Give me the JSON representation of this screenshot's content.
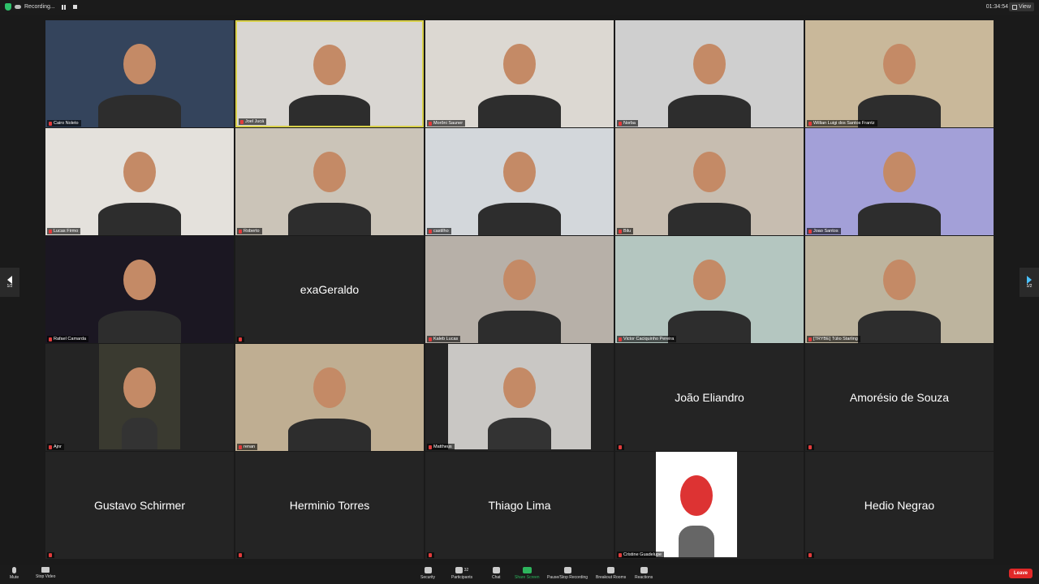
{
  "topbar": {
    "recording_label": "Recording...",
    "clock": "01:34:54",
    "view_label": "View"
  },
  "participants": [
    {
      "name": "Cairo Noleto",
      "video": true,
      "bg": "#34445c"
    },
    {
      "name": "Joel Jucá",
      "video": true,
      "bg": "#d9d6d2"
    },
    {
      "name": "Morôni Sauner",
      "video": true,
      "bg": "#dcd8d2"
    },
    {
      "name": "Norba",
      "video": true,
      "bg": "#cfcfcf"
    },
    {
      "name": "Willian Luigi dos Santos Frantz",
      "video": true,
      "bg": "#c9b89a"
    },
    {
      "name": "Lucas Firmo",
      "video": true,
      "bg": "#e4e1dc"
    },
    {
      "name": "Roberto",
      "video": true,
      "bg": "#cbc4b8"
    },
    {
      "name": "castilho",
      "video": true,
      "bg": "#d3d7db"
    },
    {
      "name": "Bilu",
      "video": true,
      "bg": "#c7bdb0"
    },
    {
      "name": "Joao Santos",
      "video": true,
      "bg": "#a3a0d8"
    },
    {
      "name": "Rafael Camarda",
      "video": true,
      "bg": "#1b1722"
    },
    {
      "name": "exaGeraldo",
      "video": false
    },
    {
      "name": "Kaleb Lucas",
      "video": true,
      "bg": "#b7b0a8"
    },
    {
      "name": "Victor Caciquinho Pereira",
      "video": true,
      "bg": "#b4c6c0"
    },
    {
      "name": "[TRYBE] Túlio Starling",
      "video": true,
      "bg": "#bdb49e"
    },
    {
      "name": "Ajnr",
      "video": true,
      "bg": "#3a3a30"
    },
    {
      "name": "renan",
      "video": true,
      "bg": "#bfae92"
    },
    {
      "name": "Mattheus",
      "video": true,
      "bg": "#c9c7c4"
    },
    {
      "name": "João Eliandro",
      "video": false
    },
    {
      "name": "Amorésio de Souza",
      "video": false
    },
    {
      "name": "Gustavo Schirmer",
      "video": false
    },
    {
      "name": "Herminio Torres",
      "video": false
    },
    {
      "name": "Thiago Lima",
      "video": false
    },
    {
      "name": "Cristine Guadelupe",
      "video": true,
      "bg": "#ffffff"
    },
    {
      "name": "Hedio Negrao",
      "video": false
    }
  ],
  "page_indicator": {
    "left": "1/2",
    "right": "1/2"
  },
  "toolbar": {
    "mute": "Mute",
    "stop_video": "Stop Video",
    "security": "Security",
    "participants": "Participants",
    "participants_count": "32",
    "chat": "Chat",
    "share_screen": "Share Screen",
    "pause_recording": "Pause/Stop Recording",
    "breakout_rooms": "Breakout Rooms",
    "reactions": "Reactions",
    "leave": "Leave"
  },
  "colors": {
    "active_speaker_border": "#d8d04a",
    "leave_red": "#e02828",
    "share_green": "#2db55d"
  }
}
